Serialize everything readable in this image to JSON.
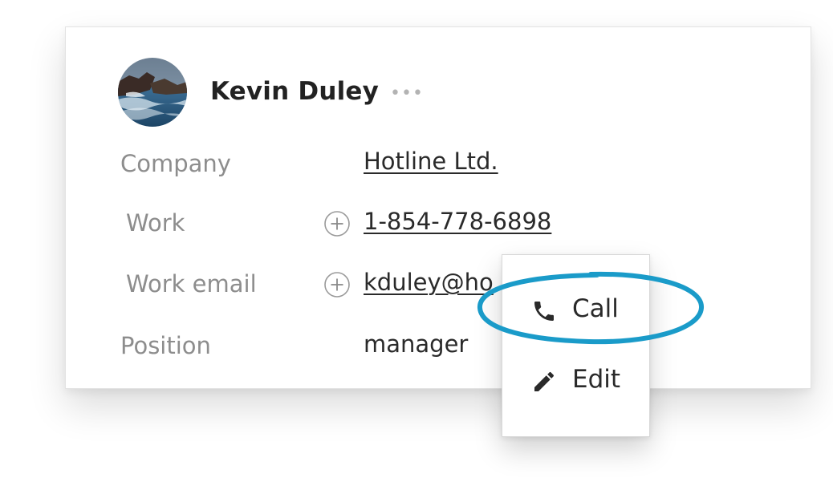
{
  "contact": {
    "name": "Kevin Duley",
    "more_icon": "more-horizontal-icon",
    "more_glyph": "•••"
  },
  "fields": {
    "company": {
      "label": "Company",
      "value": "Hotline Ltd."
    },
    "work_phone": {
      "label": "Work",
      "value": "1-854-778-6898",
      "add_icon": "plus-circle-icon"
    },
    "work_email": {
      "label": "Work email",
      "value": "kduley@ho",
      "add_icon": "plus-circle-icon"
    },
    "position": {
      "label": "Position",
      "value": "manager"
    }
  },
  "context_menu": {
    "items": [
      {
        "label": "Call",
        "icon": "phone-icon"
      },
      {
        "label": "Edit",
        "icon": "pencil-icon"
      }
    ]
  },
  "colors": {
    "highlight_ring": "#1a9bc9",
    "label_text": "#8d8d8d",
    "value_text": "#2a2a2a"
  }
}
